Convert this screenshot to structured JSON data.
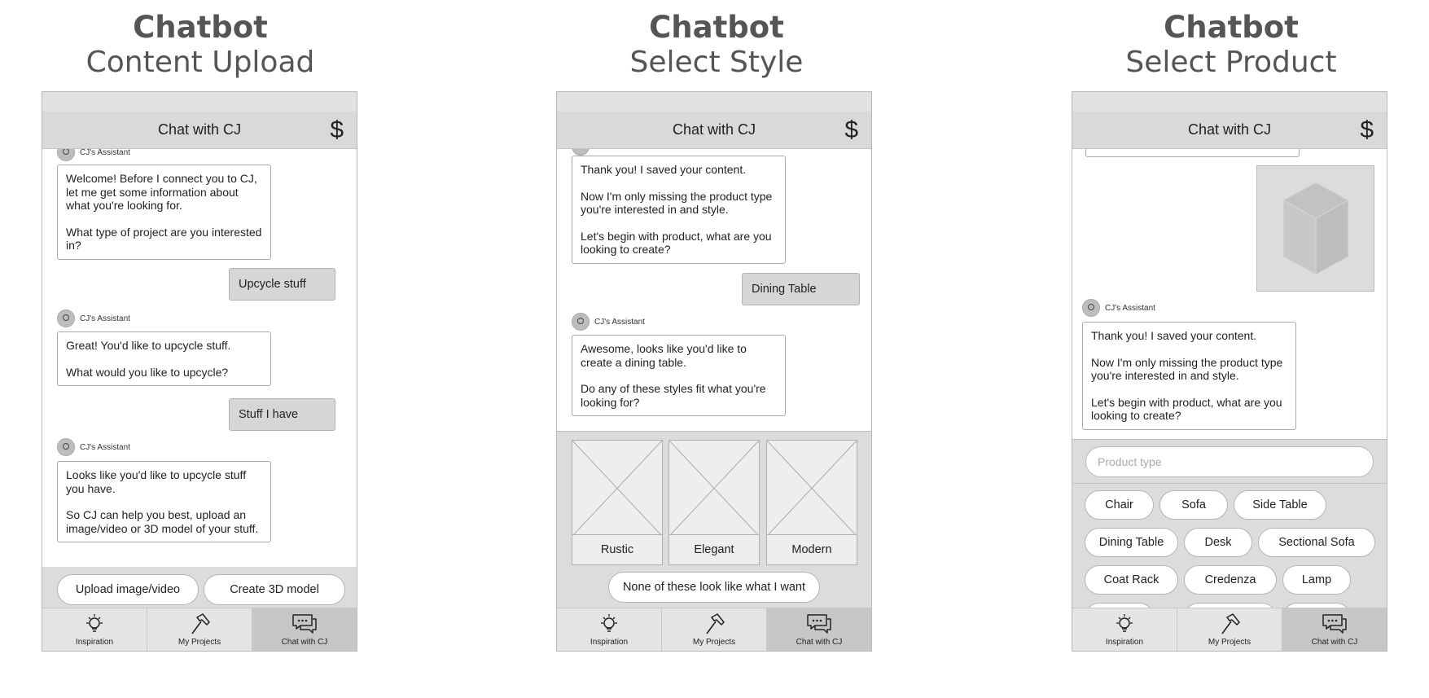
{
  "screens": [
    {
      "title": "Chatbot",
      "subtitle": "Content Upload",
      "header_title": "Chat with CJ",
      "currency_icon": "$",
      "assistant_name": "CJ's Assistant",
      "messages": {
        "bot1": [
          "Welcome! Before I connect you to CJ, let me get some information about what you're looking for.",
          "What type of project are you interested in?"
        ],
        "user1": "Upcycle stuff",
        "bot2": [
          "Great! You'd like to upcycle stuff.",
          "What would you like to upcycle?"
        ],
        "user2": "Stuff I have",
        "bot3": [
          "Looks like you'd like to upcycle stuff you have.",
          "So CJ can help you best, upload an image/video or 3D model of your stuff."
        ]
      },
      "actions": [
        "Upload image/video",
        "Create 3D model"
      ]
    },
    {
      "title": "Chatbot",
      "subtitle": "Select Style",
      "header_title": "Chat with CJ",
      "currency_icon": "$",
      "assistant_name": "CJ's Assistant",
      "messages": {
        "bot1": [
          "Thank you! I saved your content.",
          "Now I'm only missing the product type you're interested in and style.",
          "Let's begin with product, what are you looking to create?"
        ],
        "user1": "Dining Table",
        "bot2": [
          "Awesome, looks like you'd like to create a dining table.",
          "Do any of these styles fit what you're looking for?"
        ]
      },
      "styles": [
        "Rustic",
        "Elegant",
        "Modern"
      ],
      "none_option": "None of these look like what I want"
    },
    {
      "title": "Chatbot",
      "subtitle": "Select Product",
      "header_title": "Chat with CJ",
      "currency_icon": "$",
      "assistant_name": "CJ's Assistant",
      "messages": {
        "bot1": [
          "Thank you! I saved your content.",
          "Now I'm only missing the product type you're interested in and style.",
          "Let's begin with product, what are you looking to create?"
        ]
      },
      "search_placeholder": "Product type",
      "products": [
        [
          "Chair",
          "Sofa",
          "Side Table"
        ],
        [
          "Dining Table",
          "Desk",
          "Sectional Sofa"
        ],
        [
          "Coat Rack",
          "Credenza",
          "Lamp"
        ]
      ]
    }
  ],
  "nav": [
    "Inspiration",
    "My Projects",
    "Chat with CJ"
  ],
  "nav_icons": [
    "lightbulb-icon",
    "hammer-icon",
    "chat-bubbles-icon"
  ],
  "colors": {
    "title": "#555555",
    "header": "#d9d9d9",
    "active_tab": "#c7c7c7",
    "tray": "#dcdcdc"
  }
}
